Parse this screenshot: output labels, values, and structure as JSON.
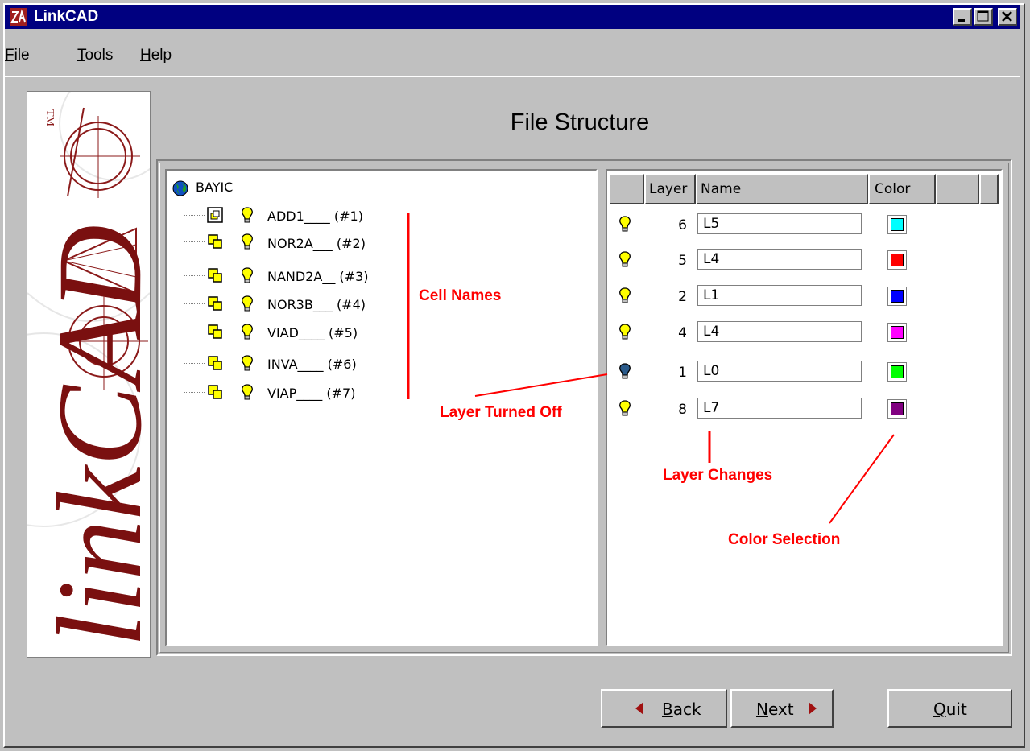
{
  "window": {
    "title": "LinkCAD"
  },
  "menu": [
    {
      "label": "File",
      "accel": "F",
      "rest": "ile"
    },
    {
      "label": "Tools",
      "accel": "T",
      "rest": "ools"
    },
    {
      "label": "Help",
      "accel": "H",
      "rest": "elp"
    }
  ],
  "logo": {
    "trademark": "TM",
    "text": "linkCAD"
  },
  "page": {
    "title": "File Structure"
  },
  "tree": {
    "root": "BAYIC",
    "cells": [
      {
        "name": "ADD1____",
        "id": "(#1)"
      },
      {
        "name": "NOR2A___",
        "id": "(#2)"
      },
      {
        "name": "NAND2A__",
        "id": "(#3)"
      },
      {
        "name": "NOR3B___",
        "id": "(#4)"
      },
      {
        "name": "VIAD____",
        "id": "(#5)"
      },
      {
        "name": "INVA____",
        "id": "(#6)"
      },
      {
        "name": "VIAP____",
        "id": "(#7)"
      }
    ]
  },
  "layers": {
    "headers": {
      "layer": "Layer",
      "name": "Name",
      "color": "Color"
    },
    "rows": [
      {
        "layer": "6",
        "name": "L5",
        "visible": true,
        "color": "#00ffff"
      },
      {
        "layer": "5",
        "name": "L4",
        "visible": true,
        "color": "#ff0000"
      },
      {
        "layer": "2",
        "name": "L1",
        "visible": true,
        "color": "#0000ff"
      },
      {
        "layer": "4",
        "name": "L4",
        "visible": true,
        "color": "#ff00ff"
      },
      {
        "layer": "1",
        "name": "L0",
        "visible": false,
        "color": "#00ff00"
      },
      {
        "layer": "8",
        "name": "L7",
        "visible": true,
        "color": "#800080"
      }
    ]
  },
  "annotations": {
    "cell_names": "Cell Names",
    "layer_off": "Layer Turned Off",
    "layer_changes": "Layer Changes",
    "color_selection": "Color Selection",
    "color": "#ff0000"
  },
  "buttons": {
    "back": {
      "accel": "B",
      "rest": "ack"
    },
    "next": {
      "accel": "N",
      "rest": "ext"
    },
    "quit": {
      "accel": "Q",
      "rest": "uit"
    }
  }
}
